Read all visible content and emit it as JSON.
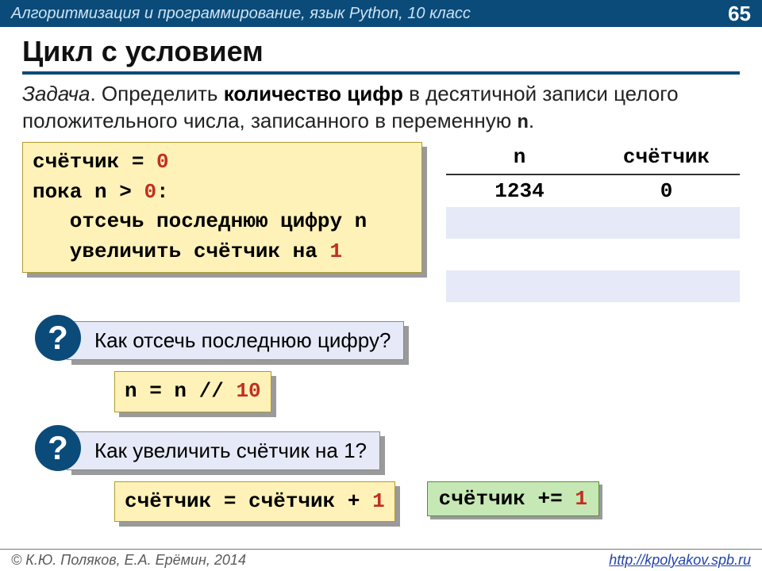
{
  "topbar": {
    "course": "Алгоритмизация и программирование, язык Python, 10 класс",
    "page": "65"
  },
  "title": "Цикл с условием",
  "task": {
    "label": "Задача",
    "text1": ". Определить ",
    "bold": "количество цифр",
    "text2": " в десятичной записи целого положительного числа, записанного в переменную ",
    "var": "n",
    "text3": "."
  },
  "code1": {
    "l1a": "счётчик = ",
    "l1b": "0",
    "l2a": "пока n > ",
    "l2b": "0",
    "l2c": ":",
    "l3": "   отсечь последнюю цифру n",
    "l4a": "   увеличить счётчик на ",
    "l4b": "1"
  },
  "trace": {
    "h1": "n",
    "h2": "счётчик",
    "rows": [
      {
        "n": "1234",
        "c": "0"
      },
      {
        "n": "",
        "c": ""
      },
      {
        "n": "",
        "c": ""
      }
    ]
  },
  "q1": {
    "mark": "?",
    "text": "Как отсечь последнюю цифру?"
  },
  "code2": {
    "a": "n = n // ",
    "b": "10"
  },
  "q2": {
    "mark": "?",
    "text": "Как увеличить счётчик на 1?"
  },
  "code3": {
    "a": "счётчик = счётчик + ",
    "b": "1"
  },
  "code4": {
    "a": "счётчик += ",
    "b": "1"
  },
  "footer": {
    "authors": "© К.Ю. Поляков, Е.А. Ерёмин, 2014",
    "url": "http://kpolyakov.spb.ru"
  }
}
